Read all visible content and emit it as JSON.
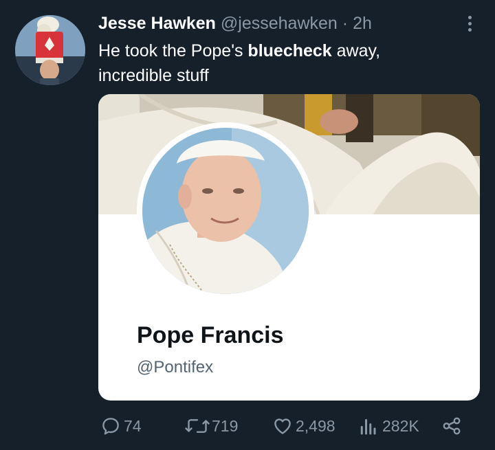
{
  "tweet": {
    "author_name": "Jesse Hawken",
    "author_handle": "@jessehawken",
    "separator": "·",
    "time": "2h",
    "text_before": "He took the Pope's ",
    "text_bold": "bluecheck",
    "text_after": " away, incredible stuff"
  },
  "card": {
    "name": "Pope Francis",
    "handle": "@Pontifex"
  },
  "actions": {
    "replies": "74",
    "retweets": "719",
    "likes": "2,498",
    "views": "282K"
  },
  "icons": {
    "more": "more-vertical-icon",
    "reply": "comment-icon",
    "retweet": "retweet-icon",
    "like": "heart-icon",
    "views": "analytics-icon",
    "share": "share-icon"
  },
  "colors": {
    "background": "#15202b",
    "secondary_text": "#8b98a5",
    "card_background": "#ffffff"
  }
}
